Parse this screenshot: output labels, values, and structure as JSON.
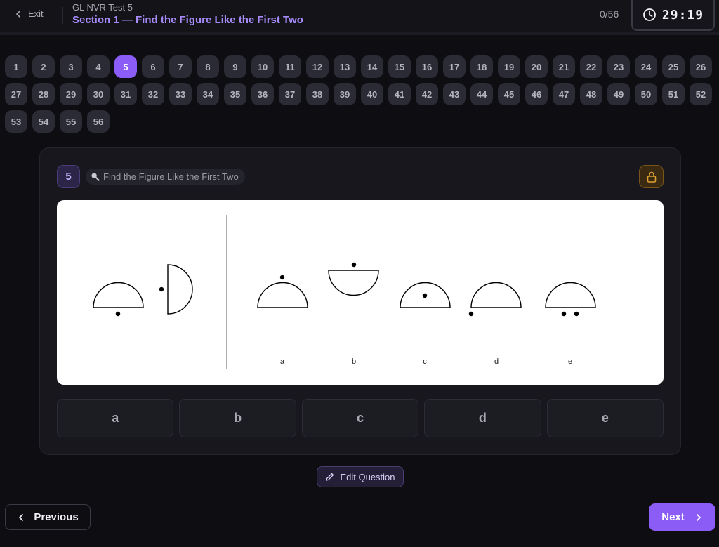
{
  "header": {
    "exit_label": "Exit",
    "test_name": "GL NVR Test 5",
    "section_title": "Section 1 — Find the Figure Like the First Two",
    "progress": "0/56",
    "timer": "29:19"
  },
  "nav": {
    "current": 5,
    "items": [
      "1",
      "2",
      "3",
      "4",
      "5",
      "6",
      "7",
      "8",
      "9",
      "10",
      "11",
      "12",
      "13",
      "14",
      "15",
      "16",
      "17",
      "18",
      "19",
      "20",
      "21",
      "22",
      "23",
      "24",
      "25",
      "26",
      "27",
      "28",
      "29",
      "30",
      "31",
      "32",
      "33",
      "34",
      "35",
      "36",
      "37",
      "38",
      "39",
      "40",
      "41",
      "42",
      "43",
      "44",
      "45",
      "46",
      "47",
      "48",
      "49",
      "50",
      "51",
      "52",
      "53",
      "54",
      "55",
      "56"
    ]
  },
  "question": {
    "number": "5",
    "type_label": "Find the Figure Like the First Two",
    "option_labels": [
      "a",
      "b",
      "c",
      "d",
      "e"
    ]
  },
  "answers": [
    "a",
    "b",
    "c",
    "d",
    "e"
  ],
  "footer": {
    "edit_label": "Edit Question",
    "prev_label": "Previous",
    "next_label": "Next"
  },
  "colors": {
    "accent": "#8b5cf6",
    "accent_text": "#a78bfa",
    "background": "#0e0e12",
    "lock_amber": "#e0a030"
  }
}
